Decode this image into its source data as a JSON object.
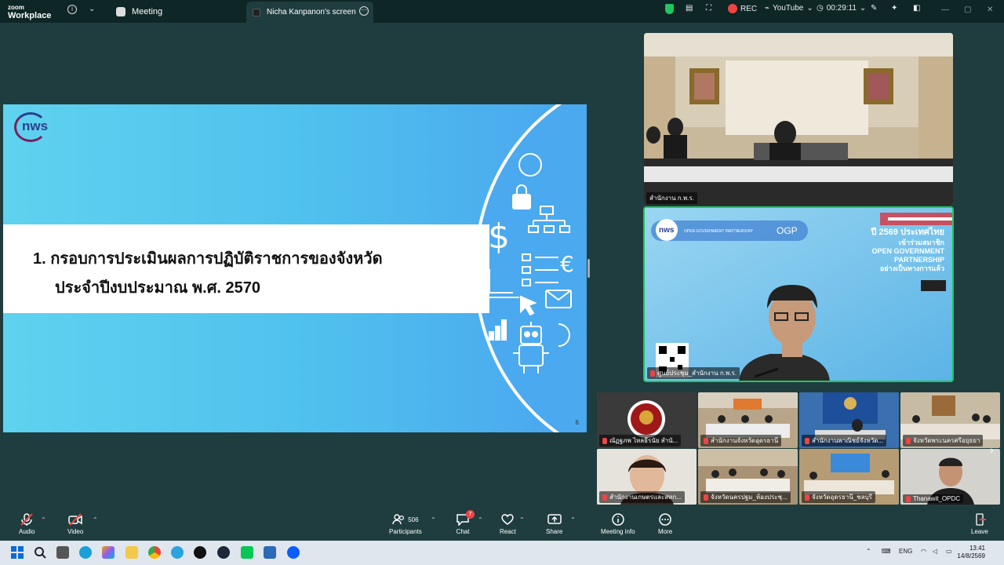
{
  "titlebar": {
    "app_line1": "zoom",
    "app_line2": "Workplace",
    "meeting_tab": "Meeting",
    "screen_tab": "Nicha Kanpanon's screen",
    "rec_label": "REC",
    "youtube_label": "YouTube",
    "timer": "00:29:11"
  },
  "slide": {
    "logo_text": "nws",
    "title_line1": "1.  กรอบการประเมินผลการปฏิบัติราชการของจังหวัด",
    "title_line2": "ประจำปีงบประมาณ พ.ศ. 2570",
    "page_number": "6"
  },
  "videos": {
    "top_label": "สำนักงาน ก.พ.ร.",
    "main_label": "ศูนย์ประชุม_สำนักงาน ก.พ.ร.",
    "main_banner_org": "OPEN GOVERNMENT PARTNERSHIP",
    "main_banner_ogp": "OGP",
    "main_banner_year": "ปี 2569 ประเทศไทย",
    "main_banner_line2": "เข้าร่วมสมาชิก",
    "main_banner_line3": "OPEN GOVERNMENT",
    "main_banner_line4": "PARTNERSHIP",
    "main_banner_line5": "อย่างเป็นทางการแล้ว",
    "main_logo": "nws"
  },
  "grid": [
    {
      "label": "ณัฏฐภพ ไหลธีรนัย สำนั..."
    },
    {
      "label": "สำนักงานจังหวัดอุดรธานี"
    },
    {
      "label": "สำนักงานพาณิชย์จังหวัด..."
    },
    {
      "label": "จังหวัดพระนครศรีอยุธยา"
    },
    {
      "label": "สำนักงานเกษตรและสหก..."
    },
    {
      "label": "จังหวัดนครปฐม_ห้องประชุ..."
    },
    {
      "label": "จังหวัดอุดรธานี_ชลบุรี"
    },
    {
      "label": "Thanawit_OPDC"
    }
  ],
  "toolbar": {
    "audio": "Audio",
    "video": "Video",
    "participants": "Participants",
    "participants_count": "506",
    "chat": "Chat",
    "chat_badge": "7",
    "react": "React",
    "share": "Share",
    "meeting_info": "Meeting info",
    "more": "More",
    "leave": "Leave"
  },
  "taskbar": {
    "lang": "ENG",
    "time": "13:41",
    "date": "14/8/2569"
  },
  "colors": {
    "meeting_bg": "#1f3d3f",
    "active_speaker": "#22c55e",
    "leave_red": "#ef4444"
  }
}
